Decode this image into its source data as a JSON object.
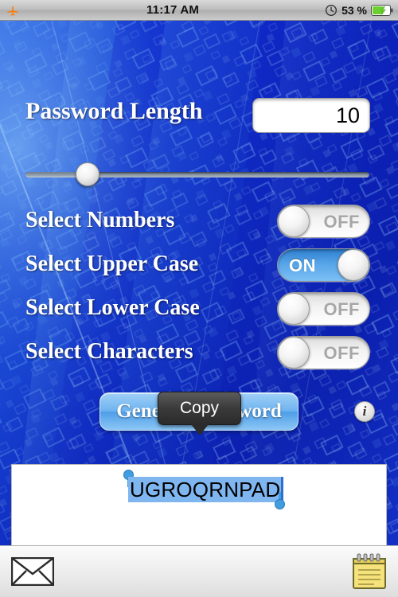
{
  "statusbar": {
    "airplane_icon": "airplane-icon",
    "time": "11:17 AM",
    "alarm_icon": "clock-icon",
    "battery_percent": "53 %",
    "battery_icon": "battery-charging-icon"
  },
  "form": {
    "length_label": "Password Length",
    "length_value": "10",
    "slider": {
      "name": "password-length-slider",
      "value": 10,
      "min": 1,
      "max": 64,
      "knob_percent": 16
    },
    "toggles": [
      {
        "label": "Select Numbers",
        "state": "OFF",
        "on": false
      },
      {
        "label": "Select Upper Case",
        "state": "ON",
        "on": true
      },
      {
        "label": "Select Lower Case",
        "state": "OFF",
        "on": false
      },
      {
        "label": "Select Characters",
        "state": "OFF",
        "on": false
      }
    ]
  },
  "actions": {
    "generate_label": "Generate Password",
    "info_label": "i",
    "copy_callout": "Copy"
  },
  "output": {
    "password": "UGROQRNPAD",
    "selected": true
  },
  "toolbar": {
    "mail_icon": "envelope-icon",
    "notes_icon": "notepad-icon"
  },
  "colors": {
    "accent_blue": "#4f9ee8",
    "switch_on": "#56a4e8",
    "selection": "#7fb6f0",
    "wallpaper_base": "#0a1fbf",
    "battery_green": "#6ccf2f"
  }
}
